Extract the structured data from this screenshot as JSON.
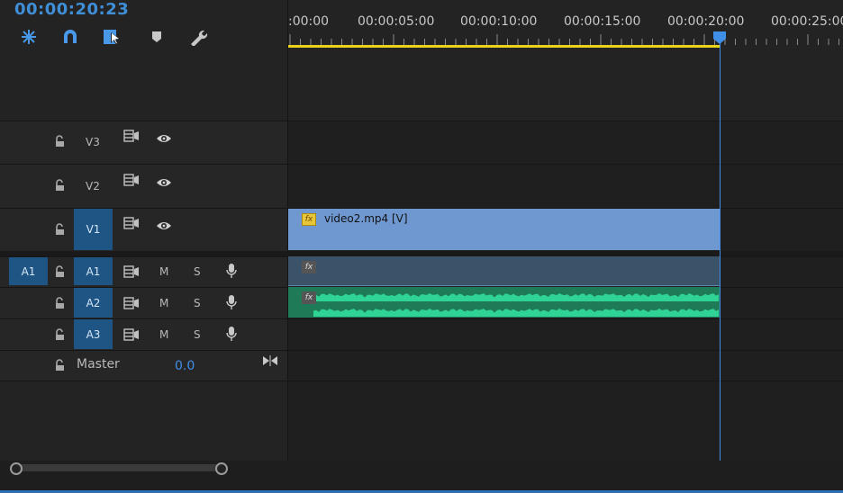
{
  "timecode": "00:00:20:23",
  "ruler": {
    "labels": [
      ":00:00",
      "00:00:05:00",
      "00:00:10:00",
      "00:00:15:00",
      "00:00:20:00",
      "00:00:25:00"
    ]
  },
  "tracks": {
    "v3": {
      "label": "V3"
    },
    "v2": {
      "label": "V2"
    },
    "v1": {
      "label": "V1"
    },
    "a1": {
      "source": "A1",
      "label": "A1",
      "mute": "M",
      "solo": "S"
    },
    "a2": {
      "label": "A2",
      "mute": "M",
      "solo": "S"
    },
    "a3": {
      "label": "A3",
      "mute": "M",
      "solo": "S"
    },
    "master": {
      "label": "Master",
      "value": "0.0"
    }
  },
  "clips": {
    "video": {
      "title": "video2.mp4 [V]",
      "fx": "fx"
    },
    "a1_fx": "fx",
    "a2_fx": "fx"
  },
  "colors": {
    "accent": "#3f8fe8",
    "video_clip": "#6f98d0",
    "audio_clip": "#1f7a57",
    "waveform": "#2fd494",
    "work_area": "#e8d21a"
  }
}
